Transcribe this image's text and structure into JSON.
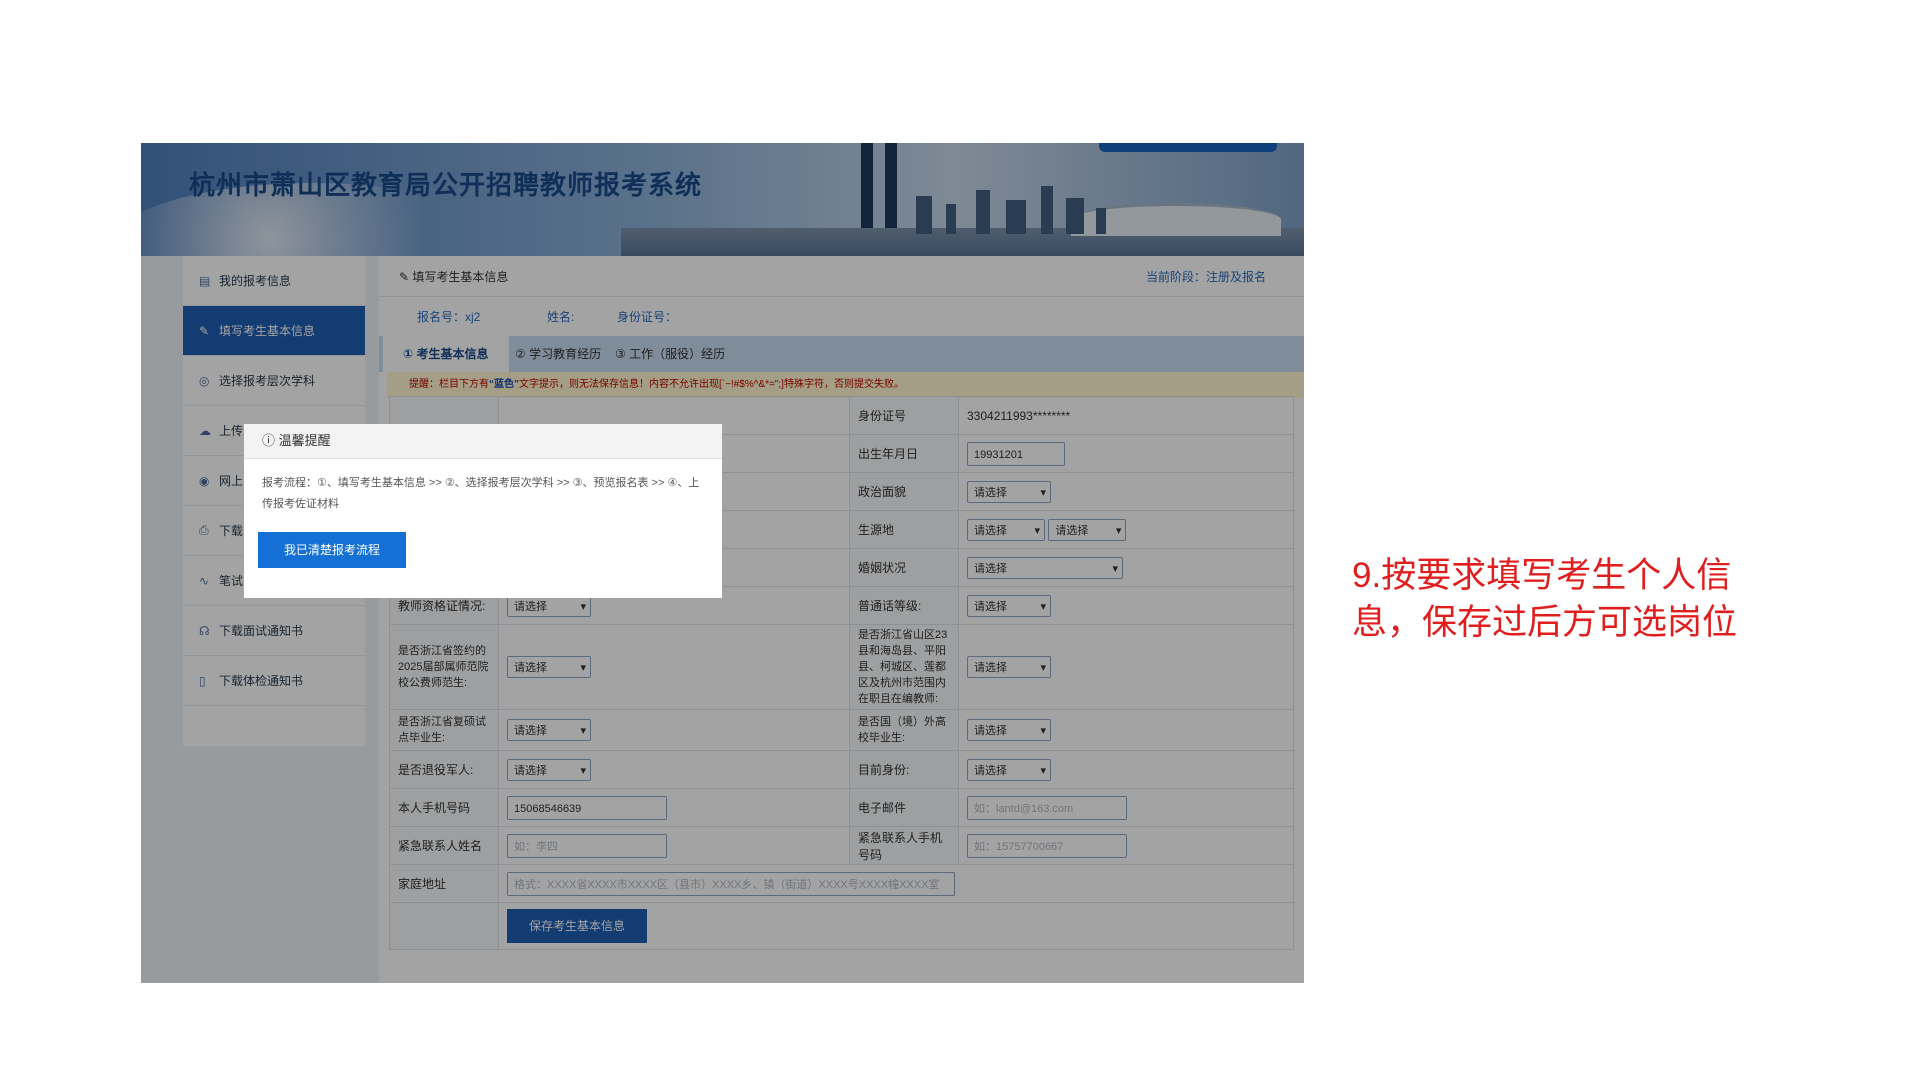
{
  "banner": {
    "title": "杭州市萧山区教育局公开招聘教师报考系统"
  },
  "sidebar": {
    "items": [
      {
        "label": "我的报考信息",
        "icon": "id-card-icon"
      },
      {
        "label": "填写考生基本信息",
        "icon": "pencil-icon"
      },
      {
        "label": "选择报考层次学科",
        "icon": "check-circle-icon"
      },
      {
        "label": "上传",
        "icon": "cloud-upload-icon"
      },
      {
        "label": "网上",
        "icon": "pay-icon"
      },
      {
        "label": "下载",
        "icon": "print-icon"
      },
      {
        "label": "笔试",
        "icon": "pulse-icon"
      },
      {
        "label": "下载面试通知书",
        "icon": "headset-icon"
      },
      {
        "label": "下载体检通知书",
        "icon": "doc-icon"
      }
    ]
  },
  "main": {
    "breadcrumb": "填写考生基本信息",
    "stage": "当前阶段：注册及报名",
    "info": {
      "reg_no": "报名号：xj2",
      "name": "姓名:",
      "id_no": "身份证号："
    },
    "tabs": [
      "① 考生基本信息",
      "② 学习教育经历",
      "③ 工作（服役）经历"
    ],
    "notice_a": "提醒：栏目下方有",
    "notice_blue": "“蓝色”",
    "notice_b": "文字提示，则无法保存信息！内容不允许出现[`~!#$%^&*=\";]特殊字符，否则提交失败。"
  },
  "form": {
    "id_label": "身份证号",
    "id_value": "3304211993********",
    "birth_label": "出生年月日",
    "birth_value": "19931201",
    "politics_label": "政治面貌",
    "origin_label": "生源地",
    "marital_label": "婚姻状况",
    "teacher_cert_label": "教师资格证情况:",
    "mandarin_label": "普通话等级:",
    "contract_label": "是否浙江省签约的2025届部属师范院校公费师范生:",
    "mountain_label": "是否浙江省山区23县和海岛县、平阳县、柯城区、莲都区及杭州市范围内在职且在编教师:",
    "masters_label": "是否浙江省复硕试点毕业生:",
    "overseas_label": "是否国（境）外高校毕业生:",
    "veteran_label": "是否退役军人:",
    "current_identity_label": "目前身份:",
    "phone_label": "本人手机号码",
    "phone_value": "15068546639",
    "email_label": "电子邮件",
    "email_placeholder": "如：lantd@163.com",
    "emergency_name_label": "紧急联系人姓名",
    "emergency_name_placeholder": "如：李四",
    "emergency_phone_label": "紧急联系人手机号码",
    "emergency_phone_placeholder": "如：15757700667",
    "address_label": "家庭地址",
    "address_placeholder": "格式：XXXX省XXXX市XXXX区（县市）XXXX乡、镇（街道）XXXX号XXXX幢XXXX室",
    "select_default": "请选择",
    "save_button": "保存考生基本信息"
  },
  "modal": {
    "title": "温馨提醒",
    "body": "报考流程：①、填写考生基本信息 >> ②、选择报考层次学科 >> ③、预览报名表 >> ④、上传报考佐证材料",
    "button": "我已清楚报考流程"
  },
  "caption": "9.按要求填写考生个人信息，保存过后方可选岗位",
  "colors": {
    "primary": "#1f5fb5",
    "caption": "#e01e1e",
    "notice": "#c00000"
  }
}
